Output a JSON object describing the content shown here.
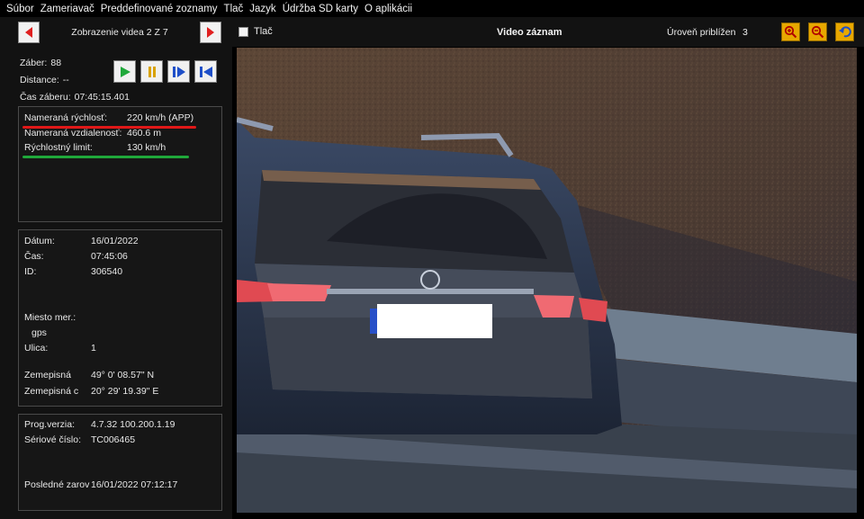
{
  "menu": [
    "Súbor",
    "Zameriavač",
    "Preddefinované zoznamy",
    "Tlač",
    "Jazyk",
    "Údržba SD karty",
    "O aplikácii"
  ],
  "nav": {
    "title": "Zobrazenie videa 2 Z 7",
    "prev_icon": "arrow-left-icon",
    "next_icon": "arrow-right-icon"
  },
  "frame": {
    "zaber_label": "Záber:",
    "zaber_value": "88",
    "distance_label": "Distance:",
    "distance_value": "--",
    "cas_label": "Čas záberu:",
    "cas_value": "07:45:15.401"
  },
  "controls": [
    "play-icon",
    "pause-icon",
    "step-forward-icon",
    "skip-to-start-icon"
  ],
  "measurement": {
    "speed_label": "Nameraná rýchlosť:",
    "speed_value": "220 km/h (APP)",
    "distance_label": "Nameraná vzdialenosť:",
    "distance_value": "460.6 m",
    "limit_label": "Rýchlostný limit:",
    "limit_value": "130 km/h",
    "colors": {
      "speed_underline": "#e01818",
      "limit_underline": "#1fa83a"
    }
  },
  "details": {
    "datum_label": "Dátum:",
    "datum_value": "16/01/2022",
    "cas_label": "Čas:",
    "cas_value": "07:45:06",
    "id_label": "ID:",
    "id_value": "306540",
    "miesto_label": "Miesto mer.:",
    "miesto_value": "gps",
    "ulica_label": "Ulica:",
    "ulica_value": "1",
    "lat_label": "Zemepisná",
    "lat_value": "49° 0' 08.57\" N",
    "lon_label": "Zemepisná c",
    "lon_value": "20° 29' 19.39\" E"
  },
  "version": {
    "prog_label": "Prog.verzia:",
    "prog_value": "4.7.32  100.200.1.19",
    "serial_label": "Sériové číslo:",
    "serial_value": "TC006465",
    "last_label": "Posledné zarov",
    "last_value": "16/01/2022  07:12:17"
  },
  "topbar": {
    "print_label": "Tlač",
    "video_title": "Video záznam",
    "zoom_label": "Úroveň priblížen",
    "zoom_value": "3",
    "tools": [
      "zoom-in-icon",
      "zoom-out-icon",
      "undo-icon"
    ]
  },
  "accent": "#e8a800"
}
